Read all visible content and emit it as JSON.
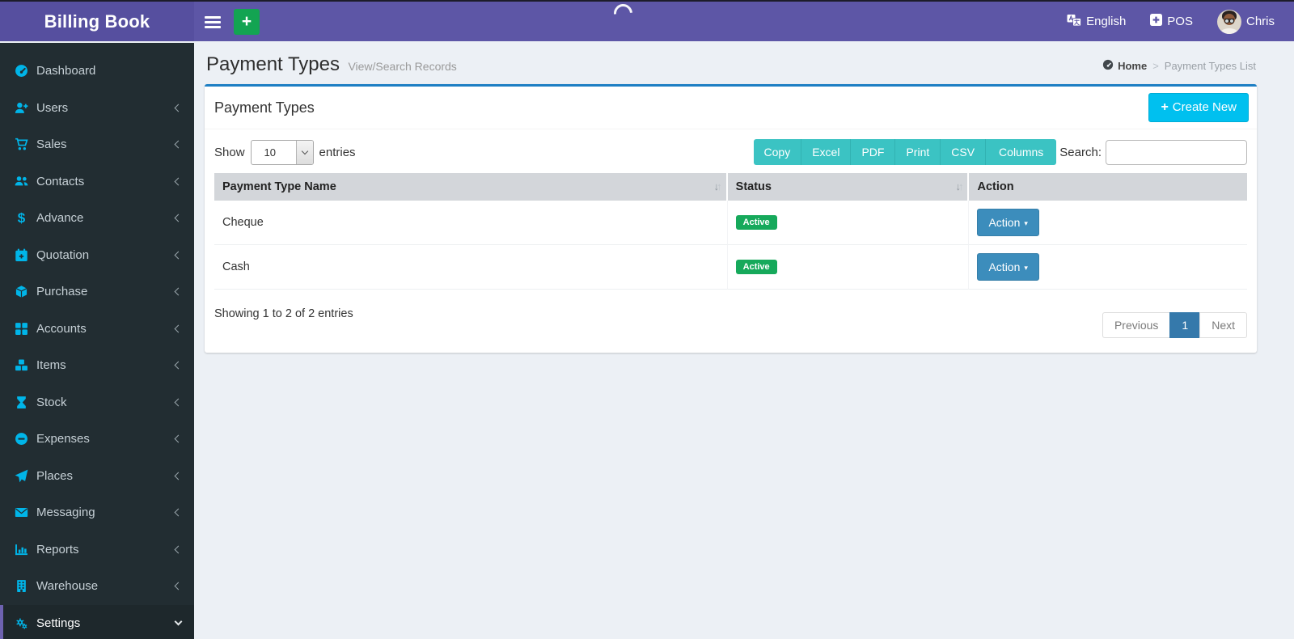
{
  "colors": {
    "navbar_purple": "#5d56a6",
    "sidebar_dark": "#222d32",
    "icon_cyan": "#00b5e9",
    "panel_top_border": "#1d7fc4",
    "export_teal": "#3bc3c3",
    "create_info_blue": "#00c0ef",
    "action_primary_blue": "#3c8dbc",
    "active_badge_green": "#16a95b",
    "quick_add_green": "#13a452"
  },
  "app": {
    "logo": "Billing Book"
  },
  "topbar": {
    "language_label": "English",
    "pos_label": "POS",
    "user_name": "Chris"
  },
  "sidebar": {
    "items": [
      {
        "label": "Dashboard"
      },
      {
        "label": "Users"
      },
      {
        "label": "Sales"
      },
      {
        "label": "Contacts"
      },
      {
        "label": "Advance"
      },
      {
        "label": "Quotation"
      },
      {
        "label": "Purchase"
      },
      {
        "label": "Accounts"
      },
      {
        "label": "Items"
      },
      {
        "label": "Stock"
      },
      {
        "label": "Expenses"
      },
      {
        "label": "Places"
      },
      {
        "label": "Messaging"
      },
      {
        "label": "Reports"
      },
      {
        "label": "Warehouse"
      },
      {
        "label": "Settings"
      }
    ]
  },
  "page": {
    "title": "Payment Types",
    "subtitle": "View/Search Records",
    "breadcrumb_home": "Home",
    "breadcrumb_sep": ">",
    "breadcrumb_current": "Payment Types List"
  },
  "panel": {
    "title": "Payment Types",
    "create_new_label": "Create New",
    "show_label": "Show",
    "entries_label": "entries",
    "page_length_value": "10",
    "export_buttons": [
      "Copy",
      "Excel",
      "PDF",
      "Print",
      "CSV",
      "Columns"
    ],
    "search_label": "Search:",
    "search_value": "",
    "table": {
      "headers": [
        "Payment Type Name",
        "Status",
        "Action"
      ],
      "rows": [
        {
          "name": "Cheque",
          "status": "Active",
          "action_label": "Action"
        },
        {
          "name": "Cash",
          "status": "Active",
          "action_label": "Action"
        }
      ]
    },
    "info_text": "Showing 1 to 2 of 2 entries",
    "pagination": {
      "previous_label": "Previous",
      "current_page": "1",
      "next_label": "Next"
    }
  }
}
